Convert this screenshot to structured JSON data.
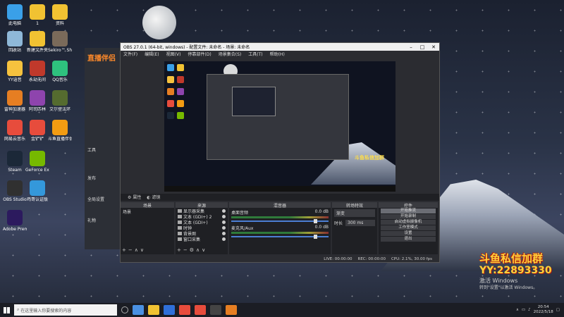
{
  "desktop": {
    "icons": [
      {
        "label": "此电脑",
        "color": "#3aa0e8"
      },
      {
        "label": "1",
        "color": "#f1c232"
      },
      {
        "label": "资料",
        "color": "#f1c232"
      },
      {
        "label": "回收站",
        "color": "#8fb8d8"
      },
      {
        "label": "新建文件夹",
        "color": "#f1c232"
      },
      {
        "label": "Sekiro™ Shadow...",
        "color": "#7a6a5a"
      },
      {
        "label": "YY语音",
        "color": "#f6c23e"
      },
      {
        "label": "永劫无间",
        "color": "#c0392b"
      },
      {
        "label": "QQ音乐",
        "color": "#2ec27e"
      },
      {
        "label": "雷神加速器",
        "color": "#e67e22"
      },
      {
        "label": "阿司匹林",
        "color": "#8e44ad"
      },
      {
        "label": "艾尔登法环",
        "color": "#556b2f"
      },
      {
        "label": "网易云音乐",
        "color": "#e74c3c"
      },
      {
        "label": "金铲铲",
        "color": "#e74c3c"
      },
      {
        "label": "斗鱼直播伴侣",
        "color": "#f39c12"
      },
      {
        "label": "Steam",
        "color": "#1b2838"
      },
      {
        "label": "GeForce Experience",
        "color": "#76b900"
      },
      {
        "label": "OBS Studio",
        "color": "#303030"
      },
      {
        "label": "鸡哥认证版",
        "color": "#3498db"
      },
      {
        "label": "Adobe Premie...",
        "color": "#2c1a5e"
      }
    ]
  },
  "bg_app": {
    "logo": "直播伴侣",
    "items": [
      "工具",
      "发布",
      "全局设置",
      "礼物",
      "主播"
    ]
  },
  "obs": {
    "title": "OBS 27.0.1 (64-bit, windows) - 配置文件: 未命名 - 场景: 未命名",
    "menu": [
      "文件(F)",
      "编辑(E)",
      "视图(V)",
      "停靠部件(D)",
      "场景集合(S)",
      "工具(T)",
      "帮助(H)"
    ],
    "source_toolbar": [
      "属性",
      "滤镜"
    ],
    "docks": {
      "scenes": {
        "header": "场景",
        "items": [
          "场景"
        ]
      },
      "sources": {
        "header": "来源",
        "items": [
          "显示器采集",
          "文本 (GDI+) 2",
          "文本 (GDI+)",
          "时钟",
          "背景图",
          "窗口采集"
        ]
      },
      "mixer": {
        "header": "混音器",
        "channels": [
          {
            "name": "桌面音频",
            "db": "0.0 dB"
          },
          {
            "name": "麦克风/Aux",
            "db": "0.0 dB"
          }
        ]
      },
      "transitions": {
        "header": "转场特效",
        "type": "渐变",
        "duration_label": "时长",
        "duration": "300 ms"
      },
      "controls": {
        "header": "控件",
        "buttons": [
          "开始推流",
          "开始录制",
          "启动虚拟摄像机",
          "工作室模式",
          "设置",
          "退出"
        ]
      }
    },
    "status": {
      "live": "LIVE: 00:00:00",
      "rec": "REC: 00:00:00",
      "cpu": "CPU: 2.1%, 30.00 fps"
    }
  },
  "preview": {
    "watermark": "斗鱼私信加群"
  },
  "overlay": {
    "line1": "斗鱼私信加群",
    "line2": "YY:22893330",
    "activate1": "激活 Windows",
    "activate2": "转到\"设置\"以激活 Windows。"
  },
  "taskbar": {
    "search_placeholder": "在这里输入你要搜索的内容",
    "time": "20:54",
    "date": "2022/5/18"
  }
}
